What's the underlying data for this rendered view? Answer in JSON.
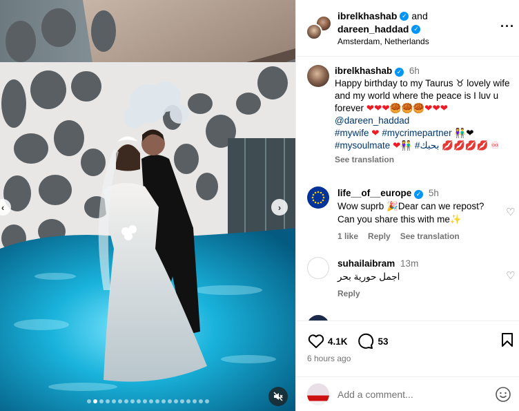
{
  "post": {
    "author1": "ibrelkhashab",
    "and_word": "and",
    "author2": "dareen_haddad",
    "location": "Amsterdam, Netherlands",
    "more_icon": "more-horizontal-icon"
  },
  "caption": {
    "username": "ibrelkhashab",
    "time": "6h",
    "text_a": "Happy birthday to my Taurus ♉ lovely wife and my world where the peace is I luv u forever",
    "emojis_a": "❤❤❤🥮🥮🥮❤❤❤",
    "mention": "@dareen_haddad",
    "tag1": "#mywife",
    "tag2": "#mycrimepartner",
    "emojis_b": "👫❤",
    "tag3": "#mysoulmate",
    "tag4": "#بحبك",
    "emojis_c": "💋💋💋💋 ♾",
    "see_translation": "See translation"
  },
  "comments": [
    {
      "username": "life__of__europe",
      "time": "5h",
      "text": "Wow suprb 🎉Dear can we repost? Can you share this with me✨",
      "likes": "1 like",
      "reply": "Reply",
      "see_translation": "See translation"
    },
    {
      "username": "suhailaibram",
      "time": "13m",
      "text": "اجمل حورية بحر",
      "reply": "Reply"
    }
  ],
  "actions": {
    "likes_count": "4.1K",
    "comments_count": "53",
    "posted_ago": "6 hours ago"
  },
  "add_comment": {
    "placeholder": "Add a comment..."
  },
  "carousel": {
    "total_slides": 20,
    "active_slide": 2
  },
  "colors": {
    "verified_badge": "#0095f6",
    "link": "#00376b",
    "muted_text": "#737373"
  }
}
